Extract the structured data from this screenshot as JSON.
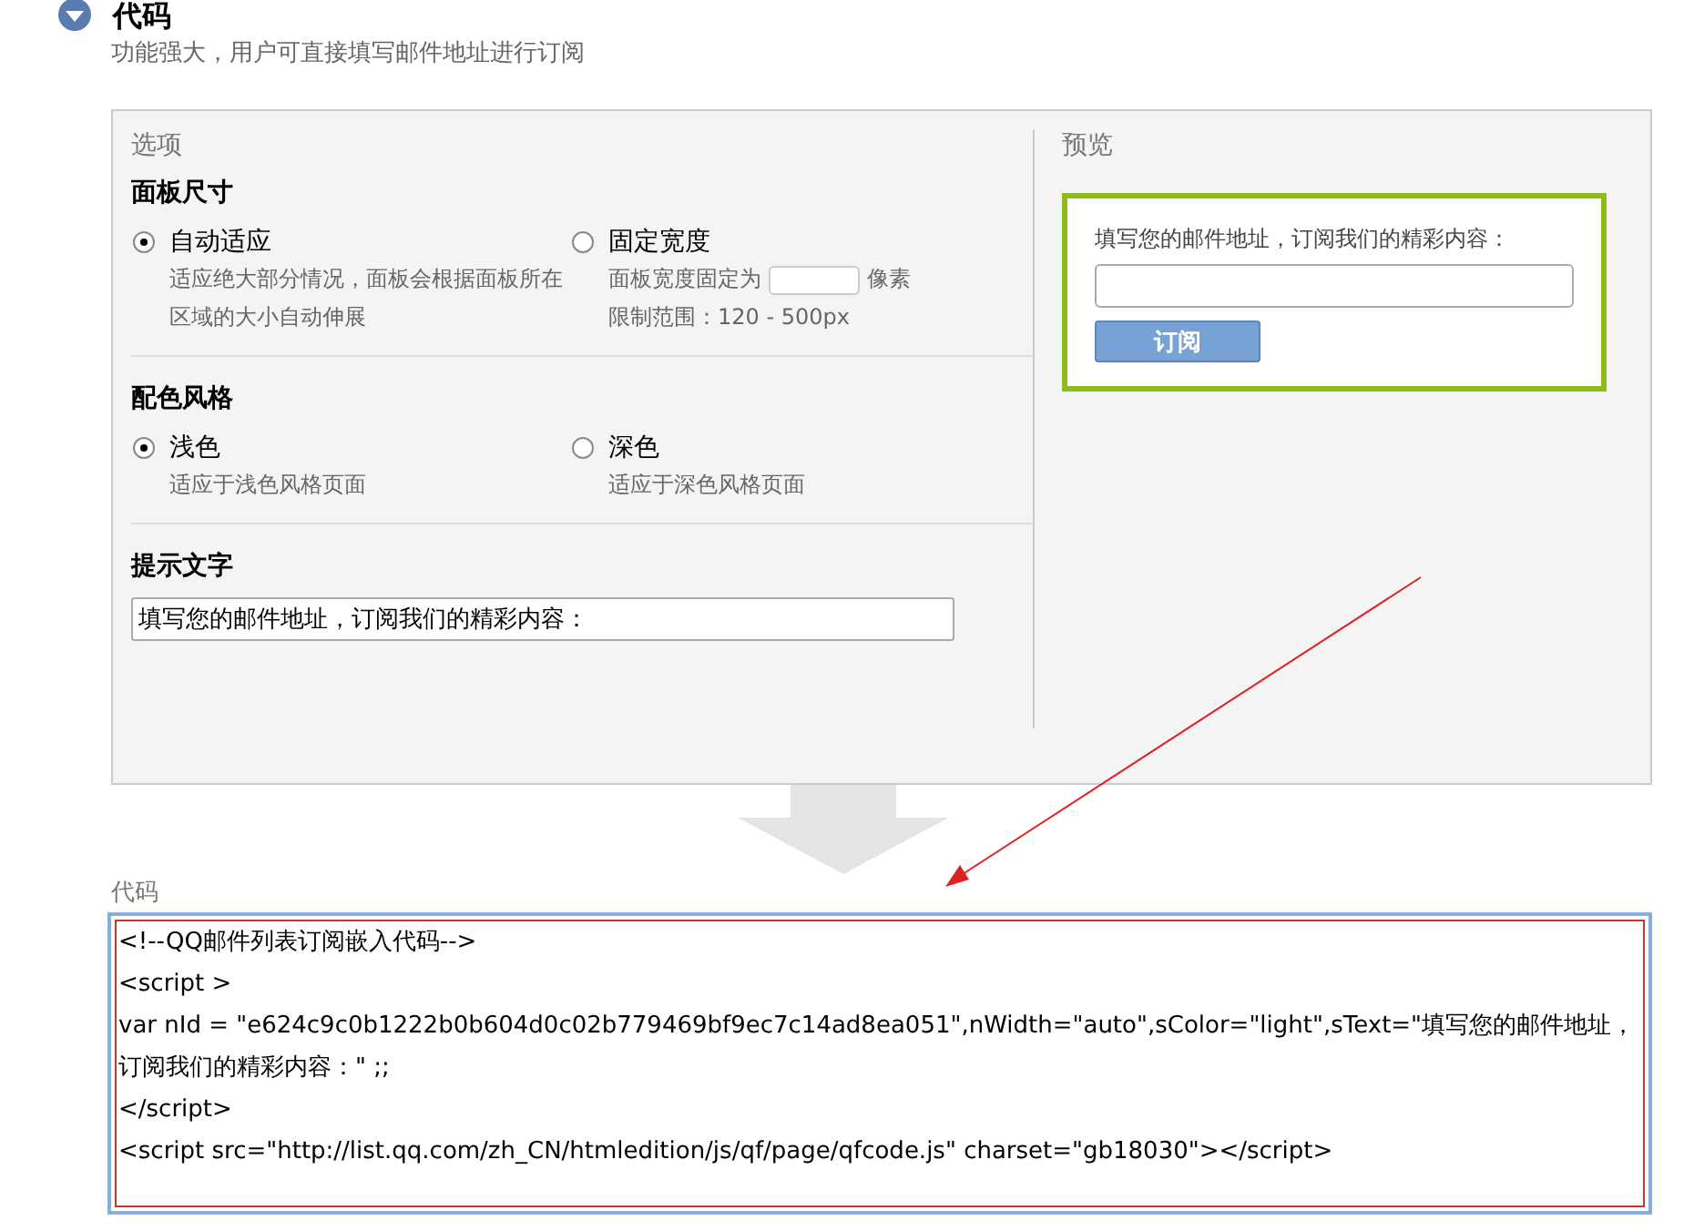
{
  "header": {
    "title": "代码",
    "subtitle": "功能强大，用户可直接填写邮件地址进行订阅",
    "expanded": true
  },
  "options": {
    "title": "选项",
    "groups": [
      {
        "heading": "面板尺寸",
        "choices": [
          {
            "kind": "plain",
            "label": "自动适应",
            "selected": true,
            "note": "适应绝大部分情况，面板会根据面板所在区域的大小自动伸展"
          },
          {
            "kind": "width",
            "label": "固定宽度",
            "selected": false,
            "prefix": "面板宽度固定为",
            "suffix": "像素",
            "range": "限制范围：120 - 500px"
          }
        ]
      },
      {
        "heading": "配色风格",
        "choices": [
          {
            "kind": "plain",
            "label": "浅色",
            "selected": true,
            "note": "适应于浅色风格页面"
          },
          {
            "kind": "plain",
            "label": "深色",
            "selected": false,
            "note": "适应于深色风格页面"
          }
        ]
      }
    ],
    "hint": {
      "heading": "提示文字",
      "value": "填写您的邮件地址，订阅我们的精彩内容："
    }
  },
  "preview": {
    "title": "预览",
    "prompt": "填写您的邮件地址，订阅我们的精彩内容：",
    "button": "订阅"
  },
  "code": {
    "label": "代码",
    "lines": [
      "<!--QQ邮件列表订阅嵌入代码-->",
      "<script >",
      "var nId = \"e624c9c0b1222b0b604d0c02b779469bf9ec7c14ad8ea051\",nWidth=\"auto\",sColor=\"light\",sText=\"填写您的邮件地址，订阅我们的精彩内容：\" ;;",
      "</script>",
      "<script src=\"http://list.qq.com/zh_CN/htmledition/js/qf/page/qfcode.js\" charset=\"gb18030\"></script>"
    ]
  }
}
